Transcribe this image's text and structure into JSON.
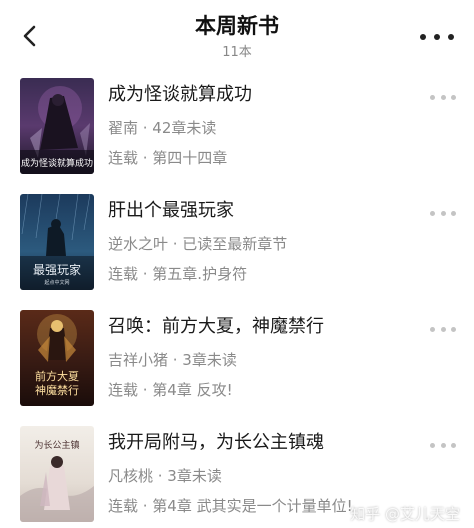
{
  "header": {
    "title": "本周新书",
    "subtitle": "11本"
  },
  "books": [
    {
      "title": "成为怪谈就算成功",
      "meta": "翟南 · 42章未读",
      "status": "连载 · 第四十四章",
      "cover_text": "成为怪谈就算成功"
    },
    {
      "title": "肝出个最强玩家",
      "meta": "逆水之叶 · 已读至最新章节",
      "status": "连载 · 第五章.护身符",
      "cover_text": "最强玩家",
      "cover_subtext": "起点中文网"
    },
    {
      "title": "召唤：前方大夏，神魔禁行",
      "meta": "吉祥小猪 · 3章未读",
      "status": "连载 · 第4章 反攻!",
      "cover_text": "前方大夏",
      "cover_text2": "神魔禁行"
    },
    {
      "title": "我开局附马，为长公主镇魂",
      "meta": "凡核桃 · 3章未读",
      "status": "连载 · 第4章 武其实是一个计量单位!",
      "cover_text": "为长公主镇"
    }
  ],
  "watermark": "知乎 @艾儿天空",
  "colors": {
    "title": "#111111",
    "meta": "#8a8a8a",
    "dots": "#c4c4c4"
  },
  "icons": {
    "back": "chevron-left-icon",
    "more": "more-horizontal-icon"
  }
}
